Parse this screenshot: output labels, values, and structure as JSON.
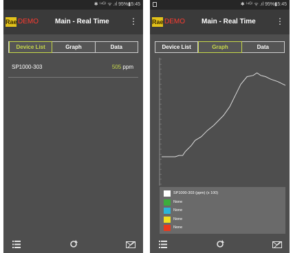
{
  "statusbar": {
    "time": "15:45",
    "icons_text": "✱ ⁽⁴ᴳ⁾ ᯤ .ıl 95%▮"
  },
  "app": {
    "logo_text": "Rae",
    "demo_label": "DEMO",
    "title": "Main - Real Time",
    "menu_icon": "⋮"
  },
  "tabs": [
    "Device List",
    "Graph",
    "Data"
  ],
  "device_list": [
    {
      "name": "SP1000-303",
      "value": "505",
      "unit": " ppm"
    }
  ],
  "legend": [
    {
      "label": "SP1000-303 (ppm) (x 100)",
      "color": "#ffffff"
    },
    {
      "label": "None",
      "color": "#3cae3c"
    },
    {
      "label": "None",
      "color": "#2bb6d8"
    },
    {
      "label": "None",
      "color": "#f0e020"
    },
    {
      "label": "None",
      "color": "#e83a1e"
    }
  ],
  "bottom_icons": {
    "list": "list-icon",
    "refresh": "refresh-icon",
    "mail": "mail-icon"
  },
  "chart_data": {
    "type": "line",
    "title": "",
    "xlabel": "",
    "ylabel": "",
    "grid": false,
    "ylim": [
      0,
      100
    ],
    "series": [
      {
        "name": "SP1000-303 (ppm) (x 100)",
        "x": [
          0,
          6,
          11,
          14,
          17,
          19,
          21,
          24,
          27,
          32,
          37,
          42,
          50,
          55,
          58,
          61,
          64,
          69,
          74,
          77,
          80,
          84,
          88,
          94,
          100
        ],
        "values": [
          22,
          22,
          22,
          23,
          23,
          26,
          28,
          31,
          35,
          38,
          43,
          47,
          55,
          62,
          68,
          74,
          80,
          86,
          87,
          89,
          87,
          86,
          84,
          82,
          79
        ]
      }
    ]
  }
}
